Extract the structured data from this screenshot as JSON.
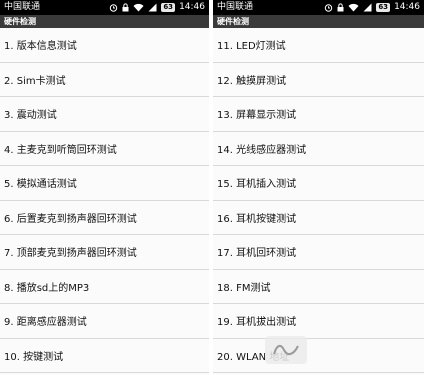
{
  "left": {
    "status": {
      "carrier": "中国联通",
      "battery": "63",
      "time": "14:46"
    },
    "title": "硬件检测",
    "items": [
      "1. 版本信息测试",
      "2. Sim卡测试",
      "3. 震动测试",
      "4. 主麦克到听筒回环测试",
      "5. 模拟通话测试",
      "6. 后置麦克到扬声器回环测试",
      "7. 顶部麦克到扬声器回环测试",
      "8. 播放sd上的MP3",
      "9. 距离感应器测试",
      "10. 按键测试"
    ]
  },
  "right": {
    "status": {
      "carrier": "中国联通",
      "battery": "63",
      "time": "14:46"
    },
    "title": "硬件检测",
    "items": [
      "11. LED灯测试",
      "12. 触摸屏测试",
      "13. 屏幕显示测试",
      "14. 光线感应器测试",
      "15. 耳机插入测试",
      "16. 耳机按键测试",
      "17. 耳机回环测试",
      "18. FM测试",
      "19. 耳机拔出测试",
      "20. WLAN 地址"
    ]
  },
  "colors": {
    "status_bar": "#000000",
    "title_bar": "#3a3a3a",
    "list_background": "#fbfbfb",
    "divider": "#d8d8d8"
  }
}
